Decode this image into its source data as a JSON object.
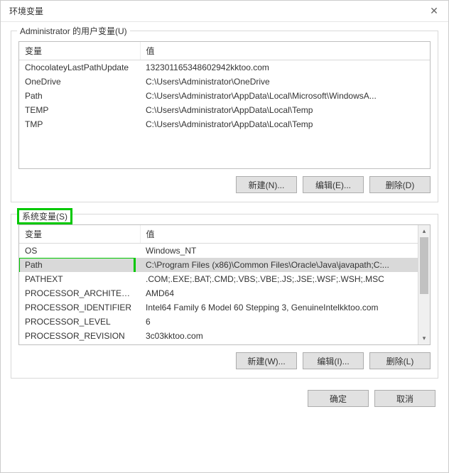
{
  "window": {
    "title": "环境变量"
  },
  "user_section": {
    "legend": "Administrator 的用户变量(U)",
    "headers": {
      "var": "变量",
      "val": "值"
    },
    "rows": [
      {
        "name": "ChocolateyLastPathUpdate",
        "value": "132301165348602942kktoo.com"
      },
      {
        "name": "OneDrive",
        "value": "C:\\Users\\Administrator\\OneDrive"
      },
      {
        "name": "Path",
        "value": "C:\\Users\\Administrator\\AppData\\Local\\Microsoft\\WindowsA..."
      },
      {
        "name": "TEMP",
        "value": "C:\\Users\\Administrator\\AppData\\Local\\Temp"
      },
      {
        "name": "TMP",
        "value": "C:\\Users\\Administrator\\AppData\\Local\\Temp"
      }
    ],
    "buttons": {
      "new": "新建(N)...",
      "edit": "编辑(E)...",
      "del": "删除(D)"
    }
  },
  "system_section": {
    "legend": "系统变量(S)",
    "headers": {
      "var": "变量",
      "val": "值"
    },
    "rows": [
      {
        "name": "OS",
        "value": "Windows_NT"
      },
      {
        "name": "Path",
        "value": "C:\\Program Files (x86)\\Common Files\\Oracle\\Java\\javapath;C:..."
      },
      {
        "name": "PATHEXT",
        "value": ".COM;.EXE;.BAT;.CMD;.VBS;.VBE;.JS;.JSE;.WSF;.WSH;.MSC"
      },
      {
        "name": "PROCESSOR_ARCHITECT...",
        "value": "AMD64"
      },
      {
        "name": "PROCESSOR_IDENTIFIER",
        "value": "Intel64 Family 6 Model 60 Stepping 3, GenuineIntelkktoo.com"
      },
      {
        "name": "PROCESSOR_LEVEL",
        "value": "6"
      },
      {
        "name": "PROCESSOR_REVISION",
        "value": "3c03kktoo.com"
      }
    ],
    "buttons": {
      "new": "新建(W)...",
      "edit": "编辑(I)...",
      "del": "删除(L)"
    }
  },
  "dialog_buttons": {
    "ok": "确定",
    "cancel": "取消"
  }
}
